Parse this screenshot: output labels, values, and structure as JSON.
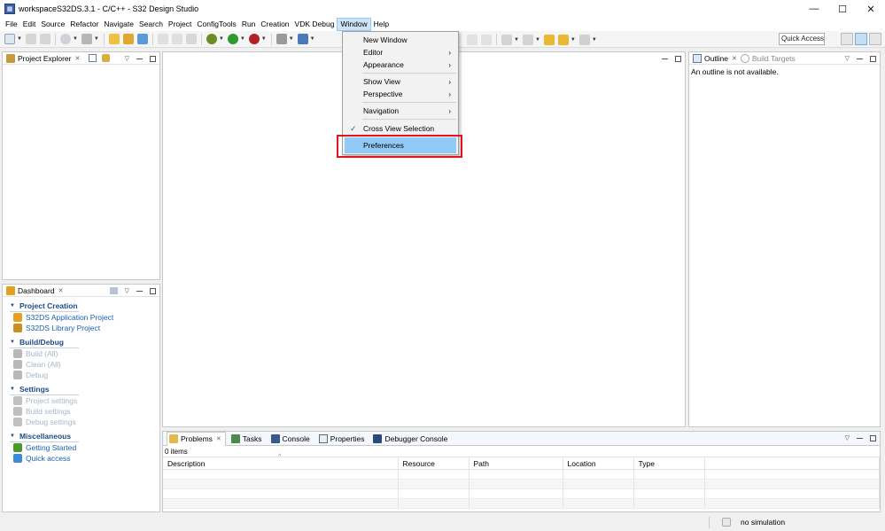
{
  "window": {
    "title": "workspaceS32DS.3.1 - C/C++ - S32 Design Studio",
    "minimize": "—",
    "maximize": "☐",
    "close": "✕"
  },
  "menubar": [
    "File",
    "Edit",
    "Source",
    "Refactor",
    "Navigate",
    "Search",
    "Project",
    "ConfigTools",
    "Run",
    "Creation",
    "VDK Debug",
    "Window",
    "Help"
  ],
  "toolbar": {
    "quick_access": "Quick Access"
  },
  "project_explorer": {
    "title": "Project Explorer",
    "close": "✕"
  },
  "dashboard": {
    "title": "Dashboard",
    "close": "✕",
    "sections": [
      {
        "title": "Project Creation",
        "items": [
          {
            "label": "S32DS Application Project",
            "enabled": true,
            "icon": "new-app-icon",
            "color": "#e8a020"
          },
          {
            "label": "S32DS Library Project",
            "enabled": true,
            "icon": "library-icon",
            "color": "#c89020"
          }
        ]
      },
      {
        "title": "Build/Debug",
        "items": [
          {
            "label": "Build   (All)",
            "enabled": false,
            "icon": "hammer-icon",
            "color": "#b8b8b8"
          },
          {
            "label": "Clean   (All)",
            "enabled": false,
            "icon": "broom-icon",
            "color": "#b8b8b8"
          },
          {
            "label": "Debug",
            "enabled": false,
            "icon": "bug-icon",
            "color": "#b8b8b8"
          }
        ]
      },
      {
        "title": "Settings",
        "items": [
          {
            "label": "Project settings",
            "enabled": false,
            "icon": "settings-icon",
            "color": "#c0c0c0"
          },
          {
            "label": "Build settings",
            "enabled": false,
            "icon": "settings-icon",
            "color": "#c0c0c0"
          },
          {
            "label": "Debug settings",
            "enabled": false,
            "icon": "settings-icon",
            "color": "#c0c0c0"
          }
        ]
      },
      {
        "title": "Miscellaneous",
        "items": [
          {
            "label": "Getting Started",
            "enabled": true,
            "icon": "getting-started-icon",
            "color": "#4a9a2a"
          },
          {
            "label": "Quick access",
            "enabled": true,
            "icon": "quick-access-icon",
            "color": "#3a8ad8"
          }
        ]
      }
    ]
  },
  "outline": {
    "title": "Outline",
    "close": "✕",
    "build_targets": "Build Targets",
    "message": "An outline is not available."
  },
  "bottom_panel": {
    "tabs": [
      "Problems",
      "Tasks",
      "Console",
      "Properties",
      "Debugger Console"
    ],
    "items_count": "0 items",
    "sort_indicator": "^",
    "columns": [
      "Description",
      "Resource",
      "Path",
      "Location",
      "Type"
    ]
  },
  "status": {
    "simulation": "no simulation"
  },
  "window_menu": {
    "items": [
      {
        "label": "New Window",
        "submenu": false
      },
      {
        "label": "Editor",
        "submenu": true
      },
      {
        "label": "Appearance",
        "submenu": true
      },
      {
        "label": "Show View",
        "submenu": true
      },
      {
        "label": "Perspective",
        "submenu": true
      },
      {
        "label": "Navigation",
        "submenu": true
      },
      {
        "label": "Cross View Selection",
        "submenu": false,
        "checked": true
      },
      {
        "label": "Preferences",
        "submenu": false,
        "highlighted": true
      }
    ],
    "submenu_arrow": "›",
    "check_mark": "✓"
  },
  "colors": {
    "highlight": "#91c9f7",
    "callout_red": "#e0141e",
    "link_blue": "#1a5fb4"
  }
}
